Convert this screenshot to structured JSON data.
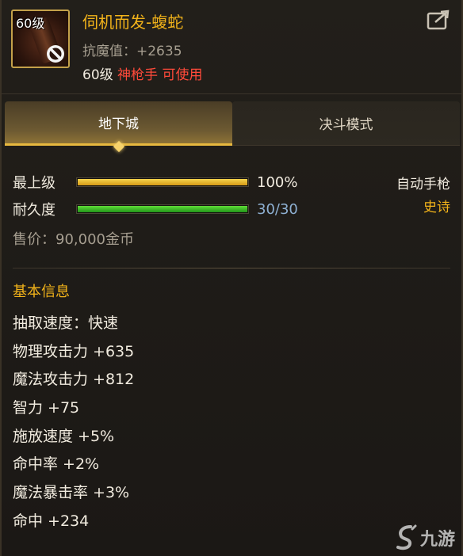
{
  "item": {
    "level_tag": "60级",
    "name": "伺机而发-蝮蛇",
    "resist": "抗魔值：+2635",
    "usage_level": "60级",
    "usage_class": "神枪手 可使用"
  },
  "tabs": [
    {
      "label": "地下城",
      "active": true
    },
    {
      "label": "决斗模式",
      "active": false
    }
  ],
  "bars": {
    "upgrade": {
      "label": "最上级",
      "value_text": "100%",
      "fill_percent": 100
    },
    "durability": {
      "label": "耐久度",
      "value_text": "30/30",
      "fill_percent": 100
    }
  },
  "weapon_type": "自动手枪",
  "rarity": "史诗",
  "price": "售价：90,000金币",
  "basic_info": {
    "title": "基本信息",
    "stats": [
      "抽取速度：快速",
      "物理攻击力 +635",
      "魔法攻击力 +812",
      "智力 +75",
      "施放速度 +5%",
      "命中率 +2%",
      "魔法暴击率 +3%",
      "命中 +234"
    ]
  },
  "watermark": "九游",
  "colors": {
    "name_gold": "#f2b31a",
    "class_red": "#ff4a3a",
    "durability_blue": "#8eb0d2",
    "tab_accent": "#e7b83f"
  },
  "icons": [
    "item-weapon-icon",
    "prohibited-icon",
    "share-icon",
    "jiuyou-logo-icon"
  ]
}
